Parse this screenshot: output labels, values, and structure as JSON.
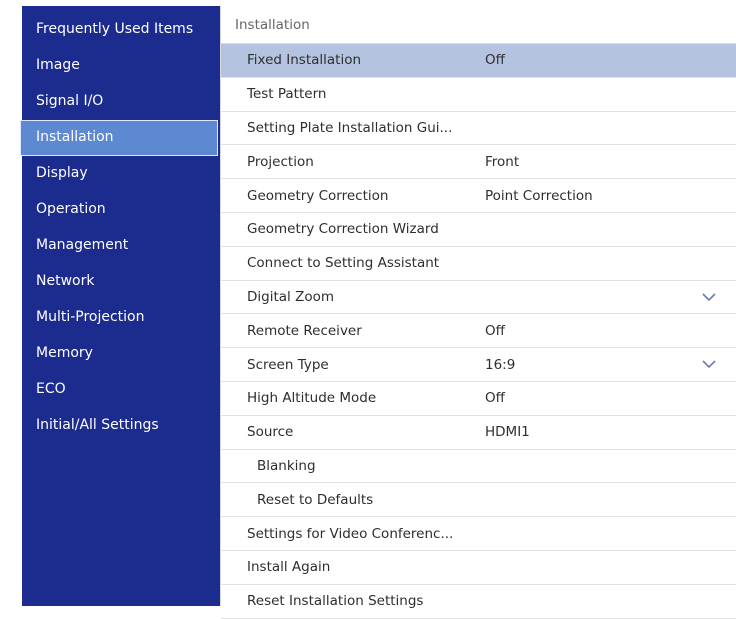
{
  "sidebar": {
    "items": [
      {
        "label": "Frequently Used Items"
      },
      {
        "label": "Image"
      },
      {
        "label": "Signal I/O"
      },
      {
        "label": "Installation"
      },
      {
        "label": "Display"
      },
      {
        "label": "Operation"
      },
      {
        "label": "Management"
      },
      {
        "label": "Network"
      },
      {
        "label": "Multi-Projection"
      },
      {
        "label": "Memory"
      },
      {
        "label": "ECO"
      },
      {
        "label": "Initial/All Settings"
      }
    ],
    "selected_index": 3
  },
  "main": {
    "title": "Installation",
    "rows": [
      {
        "label": "Fixed Installation",
        "value": "Off"
      },
      {
        "label": "Test Pattern",
        "value": ""
      },
      {
        "label": "Setting Plate Installation Gui...",
        "value": ""
      },
      {
        "label": "Projection",
        "value": "Front"
      },
      {
        "label": "Geometry Correction",
        "value": "Point Correction"
      },
      {
        "label": "Geometry Correction Wizard",
        "value": ""
      },
      {
        "label": "Connect to Setting Assistant",
        "value": ""
      },
      {
        "label": "Digital Zoom",
        "value": "",
        "chevron": true
      },
      {
        "label": "Remote Receiver",
        "value": "Off"
      },
      {
        "label": "Screen Type",
        "value": "16:9",
        "chevron": true
      },
      {
        "label": "High Altitude Mode",
        "value": "Off"
      },
      {
        "label": "Source",
        "value": "HDMI1"
      },
      {
        "label": "Blanking",
        "value": "",
        "indent": true
      },
      {
        "label": "Reset to Defaults",
        "value": "",
        "indent": true
      },
      {
        "label": "Settings for Video Conferenc...",
        "value": ""
      },
      {
        "label": "Install Again",
        "value": ""
      },
      {
        "label": "Reset Installation Settings",
        "value": ""
      }
    ],
    "selected_index": 0
  },
  "colors": {
    "sidebar_bg": "#1c2b8e",
    "sidebar_selected": "#5d88d2",
    "row_selected": "#b4c4e0"
  },
  "icons": {
    "expand": "chevron-down-icon"
  }
}
